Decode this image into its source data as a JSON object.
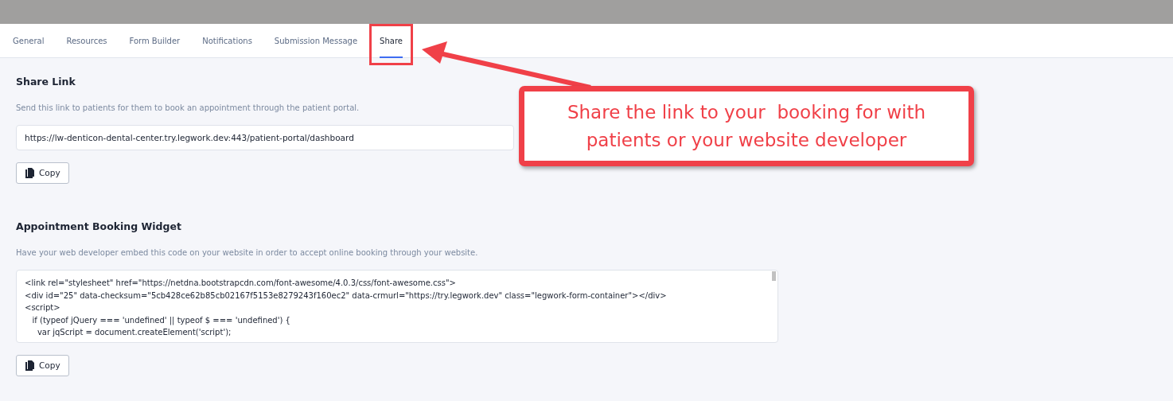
{
  "tabs": [
    {
      "label": "General",
      "selected": false
    },
    {
      "label": "Resources",
      "selected": false
    },
    {
      "label": "Form Builder",
      "selected": false
    },
    {
      "label": "Notifications",
      "selected": false
    },
    {
      "label": "Submission Message",
      "selected": false
    },
    {
      "label": "Share",
      "selected": true
    }
  ],
  "sections": [
    {
      "title": "Share Link",
      "description": "Send this link to patients for them to book an appointment through the patient portal.",
      "kind": "link",
      "value": "https://lw-denticon-dental-center.try.legwork.dev:443/patient-portal/dashboard",
      "button": "Copy"
    },
    {
      "title": "Appointment Booking Widget",
      "description": "Have your web developer embed this code on your website in order to accept online booking through your website.",
      "kind": "code",
      "lines": [
        "<link rel=\"stylesheet\" href=\"https://netdna.bootstrapcdn.com/font-awesome/4.0.3/css/font-awesome.css\">",
        "<div id=\"25\" data-checksum=\"5cb428ce62b85cb02167f5153e8279243f160ec2\" data-crmurl=\"https://try.legwork.dev\" class=\"legwork-form-container\"></div>",
        "<script>",
        "   if (typeof jQuery === 'undefined' || typeof $ === 'undefined') {",
        "     var jqScript = document.createElement('script');"
      ],
      "button": "Copy"
    }
  ],
  "annotation": {
    "text": "Share the link to your  booking for with\npatients or your website developer"
  }
}
